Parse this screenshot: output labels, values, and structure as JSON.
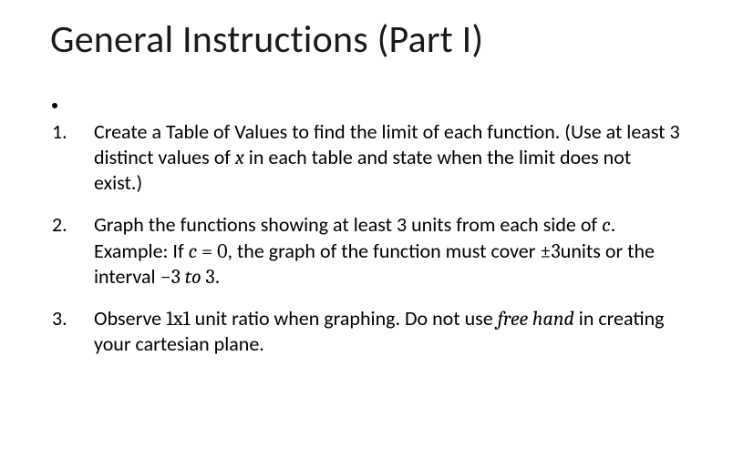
{
  "title": "General Instructions (Part I)",
  "items": [
    {
      "p1a": "Create a Table of Values to find the limit of each function. (Use at least 3 distinct values of ",
      "p1b_var": "x",
      "p1c": " in each table and state when the limit does not exist.)"
    },
    {
      "p2a": "Graph the functions showing at least 3 units from each side of ",
      "p2b_var": "c",
      "p2c": ".",
      "p2_ex_a": "Example: If ",
      "p2_ex_b_c": "c",
      "p2_ex_c_eq": " = ",
      "p2_ex_d_zero": "0",
      "p2_ex_e": ", the graph of the function must cover ",
      "p2_ex_f_pm": "±",
      "p2_ex_g_three": "3",
      "p2_ex_h": "units or the interval ",
      "p2_ex_i_minus": "−",
      "p2_ex_j_3": "3",
      "p2_ex_k_to": " to ",
      "p2_ex_l_3": "3",
      "p2_ex_m": "."
    },
    {
      "p3a": "Observe ",
      "p3b_ratio": "1x1",
      "p3c": " unit ratio when graphing. Do not use ",
      "p3d_free": "free hand",
      "p3e": " in creating your cartesian plane."
    }
  ]
}
